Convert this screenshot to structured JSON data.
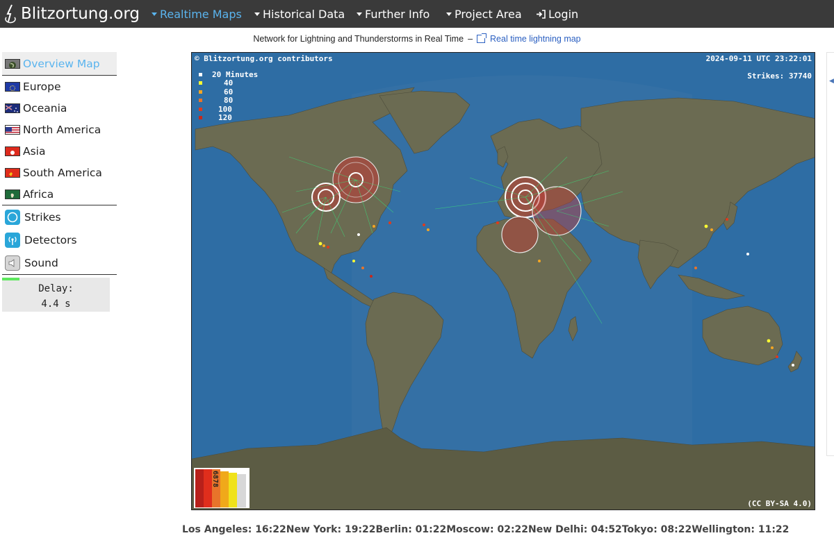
{
  "navbar": {
    "brand": "Blitzortung.org",
    "items": [
      {
        "label": "Realtime Maps",
        "active": true
      },
      {
        "label": "Historical Data",
        "active": false
      },
      {
        "label": "Further Info",
        "active": false
      },
      {
        "label": "Project Area",
        "active": false
      },
      {
        "label": "Login",
        "active": false
      }
    ]
  },
  "subheader": {
    "text": "Network for Lightning and Thunderstorms in Real Time",
    "separator": "–",
    "link": "Real time lightning map"
  },
  "sidebar": {
    "regions": [
      {
        "label": "Overview Map",
        "icon": "globe-icon",
        "active": true
      },
      {
        "label": "Europe",
        "icon": "eu-flag-icon",
        "active": false
      },
      {
        "label": "Oceania",
        "icon": "australia-flag-icon",
        "active": false
      },
      {
        "label": "North America",
        "icon": "usa-flag-icon",
        "active": false
      },
      {
        "label": "Asia",
        "icon": "hongkong-flag-icon",
        "active": false
      },
      {
        "label": "South America",
        "icon": "brazil-flag-icon",
        "active": false
      },
      {
        "label": "Africa",
        "icon": "africa-flag-icon",
        "active": false
      }
    ],
    "tools": [
      {
        "label": "Strikes",
        "icon": "strikes-icon"
      },
      {
        "label": "Detectors",
        "icon": "detectors-icon"
      },
      {
        "label": "Sound",
        "icon": "sound-icon"
      }
    ],
    "delay": {
      "label": "Delay:",
      "value": "4.4 s"
    }
  },
  "map": {
    "attribution": "© Blitzortung.org contributors",
    "timestamp": "2024-09-11 UTC 23:22:01",
    "strikes_label": "Strikes: 37740",
    "legend": [
      {
        "label": "20 Minutes",
        "color": "#ffffff"
      },
      {
        "label": "40",
        "color": "#ffff33"
      },
      {
        "label": "60",
        "color": "#f5a623"
      },
      {
        "label": "80",
        "color": "#e8742a"
      },
      {
        "label": "100",
        "color": "#e03a1c"
      },
      {
        "label": "120",
        "color": "#c8281a"
      }
    ],
    "histogram_label": "6878",
    "license": "(CC BY-SA 4.0)",
    "colors": {
      "ocean": "#2e6da4",
      "land": "#6b6b52",
      "antarctica": "#5c5c44"
    }
  },
  "clocks": [
    {
      "city": "Los Angeles",
      "time": "16:22"
    },
    {
      "city": "New York",
      "time": "19:22"
    },
    {
      "city": "Berlin",
      "time": "01:22"
    },
    {
      "city": "Moscow",
      "time": "02:22"
    },
    {
      "city": "New Delhi",
      "time": "04:52"
    },
    {
      "city": "Tokyo",
      "time": "08:22"
    },
    {
      "city": "Wellington",
      "time": "11:22"
    }
  ]
}
